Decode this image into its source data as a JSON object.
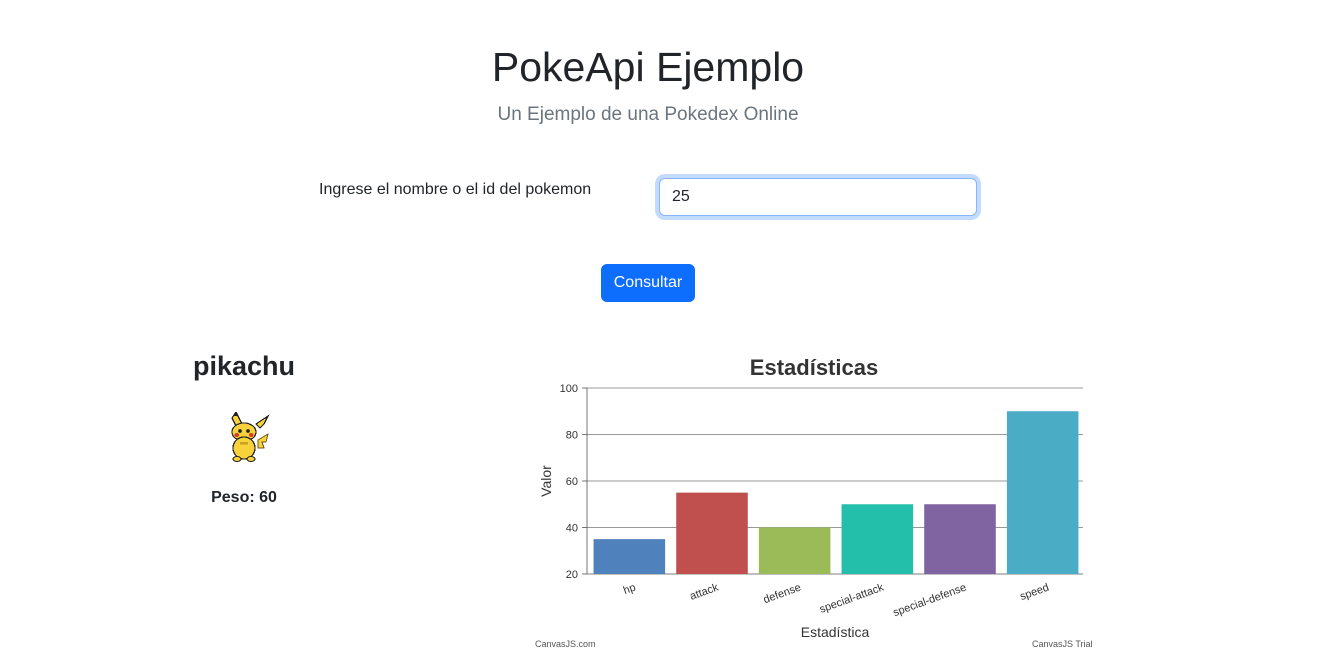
{
  "header": {
    "title": "PokeApi Ejemplo",
    "subtitle": "Un Ejemplo de una Pokedex Online"
  },
  "search": {
    "label": "Ingrese el nombre o el id del pokemon",
    "value": "25",
    "button_label": "Consultar"
  },
  "pokemon": {
    "name": "pikachu",
    "sprite_icon": "pikachu-sprite",
    "weight_text": "Peso: 60"
  },
  "chart_data": {
    "type": "bar",
    "title": "Estadísticas",
    "xlabel": "Estadística",
    "ylabel": "Valor",
    "categories": [
      "hp",
      "attack",
      "defense",
      "special-attack",
      "special-defense",
      "speed"
    ],
    "values": [
      35,
      55,
      40,
      50,
      50,
      90
    ],
    "colors": [
      "#4f81bc",
      "#c0504e",
      "#9bbb58",
      "#23bfaa",
      "#8064a1",
      "#4aacc5"
    ],
    "ylim": [
      20,
      100
    ],
    "yticks": [
      20,
      40,
      60,
      80,
      100
    ],
    "grid": true
  },
  "footer": {
    "credit_left": "CanvasJS.com",
    "credit_right": "CanvasJS Trial"
  }
}
